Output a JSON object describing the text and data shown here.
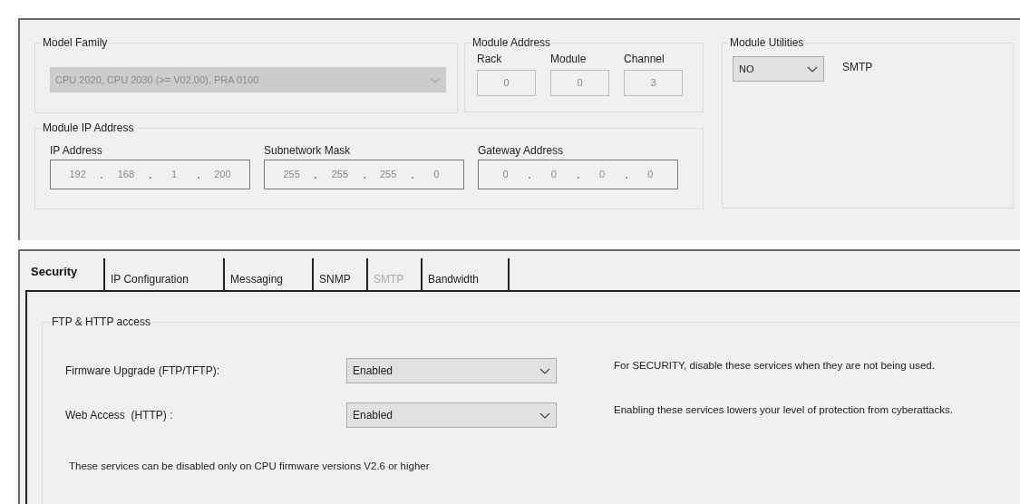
{
  "model_family": {
    "label": "Model Family",
    "value": "CPU 2020, CPU 2030 (>= V02.00), PRA 0100",
    "disabled": true
  },
  "module_address": {
    "label": "Module Address",
    "fields": [
      {
        "label": "Rack",
        "value": "0"
      },
      {
        "label": "Module",
        "value": "0"
      },
      {
        "label": "Channel",
        "value": "3"
      }
    ]
  },
  "module_ip": {
    "label": "Module IP Address",
    "fields": [
      {
        "label": "IP Address",
        "octets": [
          "192",
          "168",
          "1",
          "200"
        ]
      },
      {
        "label": "Subnetwork Mask",
        "octets": [
          "255",
          "255",
          "255",
          "0"
        ]
      },
      {
        "label": "Gateway Address",
        "octets": [
          "0",
          "0",
          "0",
          "0"
        ]
      }
    ]
  },
  "module_utilities": {
    "label": "Module Utilities",
    "value": "NO",
    "caption": "SMTP"
  },
  "tabs": [
    {
      "label": "Security",
      "selected": true,
      "disabled": false
    },
    {
      "label": "IP Configuration",
      "selected": false,
      "disabled": false
    },
    {
      "label": "Messaging",
      "selected": false,
      "disabled": false
    },
    {
      "label": "SNMP",
      "selected": false,
      "disabled": false
    },
    {
      "label": "SMTP",
      "selected": false,
      "disabled": true
    },
    {
      "label": "Bandwidth",
      "selected": false,
      "disabled": false
    }
  ],
  "access_group": {
    "label": "FTP & HTTP access",
    "rows": [
      {
        "label": "Firmware Upgrade (FTP/TFTP):",
        "value": "Enabled",
        "note": "For SECURITY, disable these services when they are not being used."
      },
      {
        "label": "Web Access  (HTTP) :",
        "value": "Enabled",
        "note": "Enabling these services lowers your level of protection from cyberattacks."
      }
    ],
    "footnote": "These services can be disabled only on CPU firmware versions V2.6 or higher"
  }
}
